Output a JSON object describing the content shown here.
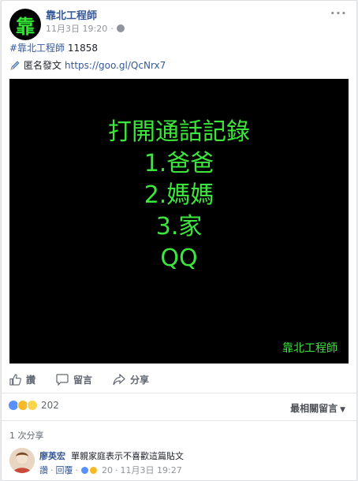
{
  "post": {
    "author": "靠北工程師",
    "avatar_glyph": "靠",
    "timestamp": "11月3日 19:20",
    "privacy_separator": "·",
    "hashtag": "#靠北工程師",
    "post_number": "11858",
    "anon_label": "匿名發文",
    "link": "https://goo.gl/QcNrx7",
    "more_label": "···"
  },
  "image": {
    "lines": [
      "打開通話記錄",
      "1.爸爸",
      "2.媽媽",
      "3.家",
      "QQ"
    ],
    "signature": "靠北工程師",
    "text_color": "#3ce63c"
  },
  "actions": {
    "like": "讚",
    "comment": "留言",
    "share": "分享"
  },
  "reactions": {
    "icons": [
      "like-icon",
      "sad-icon",
      "haha-icon"
    ],
    "count": "202",
    "sort_label": "最相關留言"
  },
  "shares": {
    "label": "1 次分享"
  },
  "comment": {
    "author": "廖英宏",
    "text": "單親家庭表示不喜歡這篇貼文",
    "like": "讚",
    "reply": "回覆",
    "reaction_count": "20",
    "timestamp": "11月3日 19:27",
    "separator": "·"
  },
  "colors": {
    "link_blue": "#365899",
    "like_blue": "#5890ff",
    "sad_yellow": "#f7b928",
    "haha_yellow": "#fcd34d"
  }
}
